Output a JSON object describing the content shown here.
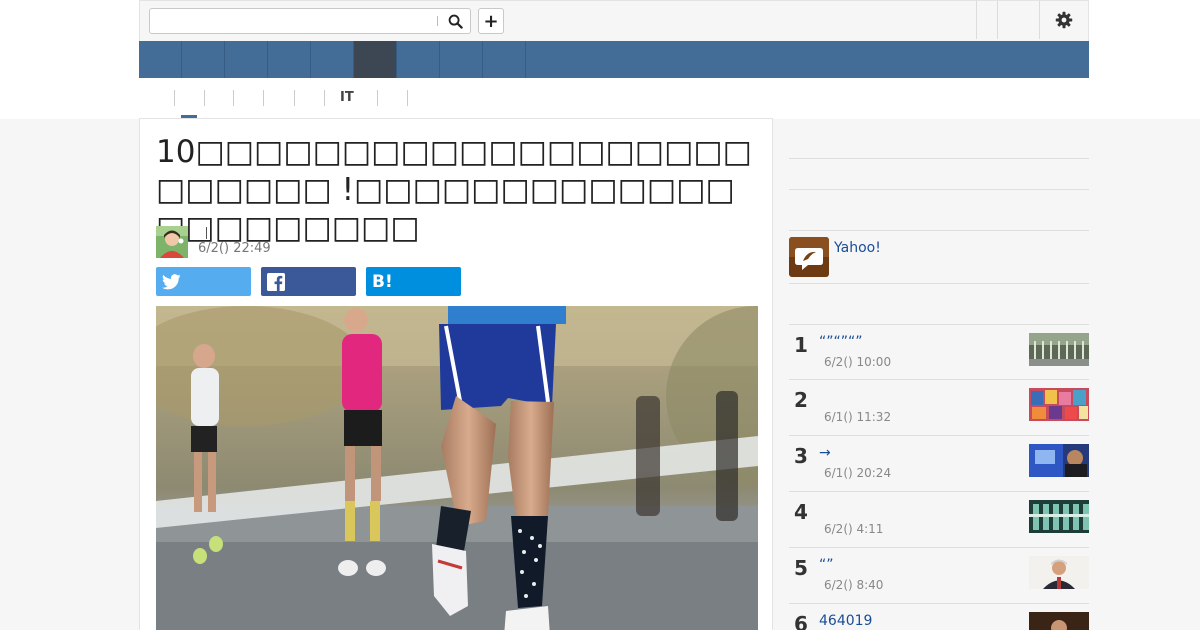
{
  "header": {
    "search": {
      "value": "",
      "placeholder": ""
    },
    "add_label": "+"
  },
  "navbar": {
    "tab_count": 9,
    "active_tab": 5
  },
  "subnav": {
    "items": [
      "",
      "",
      "",
      "",
      "",
      "IT",
      ""
    ]
  },
  "article": {
    "headline": "10□□□□□□□□□□□□□□□□□□□□□□□□□ !□□□□□□□□□□□□□□□□□□□□□□",
    "author": "",
    "date": "6/2() 22:49",
    "share": {
      "twitter": "",
      "facebook": "",
      "hatena": ""
    }
  },
  "sidebar": {
    "yahoo_label": "Yahoo!",
    "ranking": [
      {
        "rank": "1",
        "title": "“”“”“”",
        "time": "6/2() 10:00"
      },
      {
        "rank": "2",
        "title": "",
        "time": "6/1() 11:32"
      },
      {
        "rank": "3",
        "title": "→",
        "time": "6/1() 20:24"
      },
      {
        "rank": "4",
        "title": "",
        "time": "6/2() 4:11"
      },
      {
        "rank": "5",
        "title": "“”",
        "time": "6/2() 8:40"
      },
      {
        "rank": "6",
        "title": "464019",
        "time": ""
      }
    ]
  },
  "colors": {
    "nav": "#436c97",
    "nav_active": "#3d4653",
    "twitter": "#55acee",
    "facebook": "#3b5998",
    "hatena": "#008fde",
    "link": "#1a4d97"
  }
}
